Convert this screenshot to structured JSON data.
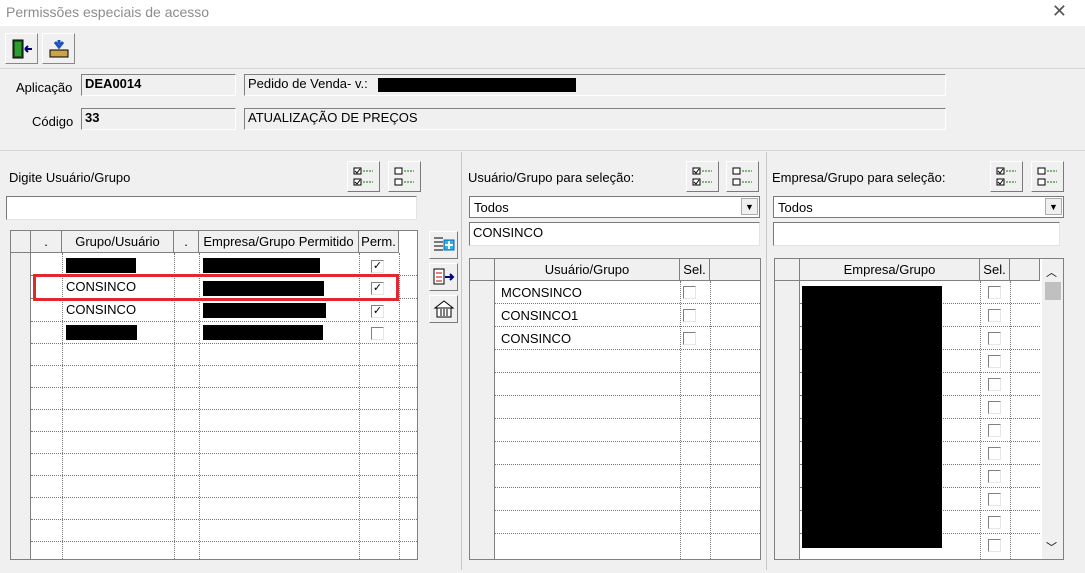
{
  "window": {
    "title": "Permissões especiais de acesso",
    "close_glyph": "✕"
  },
  "toolbar": {
    "exit_icon": "exit-door-icon",
    "save_icon": "save-tray-icon"
  },
  "header": {
    "aplicacao_label": "Aplicação",
    "aplicacao_value": "DEA0014",
    "aplicacao_desc": "Pedido de Venda- v.:",
    "codigo_label": "Código",
    "codigo_value": "33",
    "codigo_desc": "ATUALIZAÇÃO DE PREÇOS"
  },
  "left_panel": {
    "label": "Digite Usuário/Grupo",
    "search_value": "",
    "columns": [
      ".",
      "Grupo/Usuário",
      ".",
      "Empresa/Grupo Permitido",
      "Perm."
    ],
    "rows": [
      {
        "user": "",
        "perm": true
      },
      {
        "user": "CONSINCO",
        "perm": true
      },
      {
        "user": "CONSINCO",
        "perm": true
      },
      {
        "user": "",
        "perm": false
      }
    ]
  },
  "middle_panel": {
    "label": "Usuário/Grupo para seleção:",
    "filter_value": "Todos",
    "search_value": "CONSINCO",
    "columns": [
      "Usuário/Grupo",
      "Sel."
    ],
    "rows": [
      {
        "name": "MCONSINCO",
        "sel": false
      },
      {
        "name": "CONSINCO1",
        "sel": false
      },
      {
        "name": "CONSINCO",
        "sel": false
      }
    ]
  },
  "right_panel": {
    "label": "Empresa/Grupo para seleção:",
    "filter_value": "Todos",
    "search_value": "",
    "columns": [
      "Empresa/Grupo",
      "Sel."
    ]
  },
  "colors": {
    "highlight": "#e0282e",
    "redaction": "#000000"
  }
}
